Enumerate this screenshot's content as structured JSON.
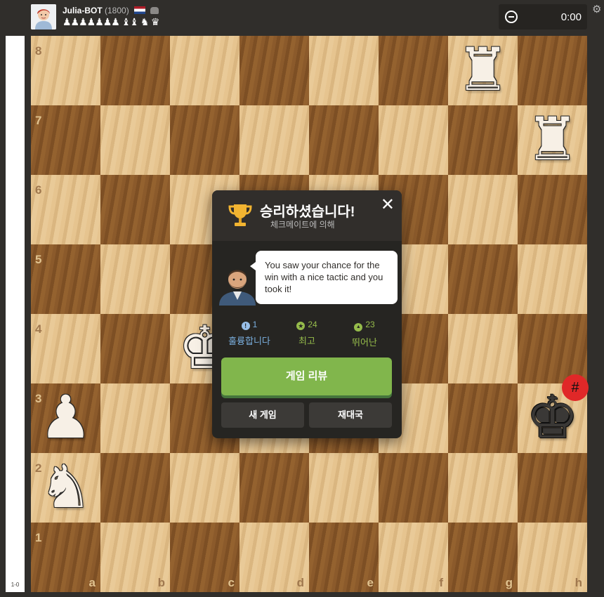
{
  "player": {
    "name": "Julia-BOT",
    "rating": "(1800)",
    "flag_icon": "netherlands-flag-icon",
    "bot_icon": "bot-icon",
    "captured": "♟♟♟♟♟♟♟ ♝♝ ♞ ♛"
  },
  "clock": {
    "icon": "timer-icon",
    "time": "0:00"
  },
  "settings_icon": "gear-icon",
  "eval": {
    "score": "1-0"
  },
  "board": {
    "ranks": [
      "8",
      "7",
      "6",
      "5",
      "4",
      "3",
      "2",
      "1"
    ],
    "files": [
      "a",
      "b",
      "c",
      "d",
      "e",
      "f",
      "g",
      "h"
    ],
    "pieces": [
      {
        "square": "g8",
        "symbol": "♜",
        "color": "white"
      },
      {
        "square": "h7",
        "symbol": "♜",
        "color": "white"
      },
      {
        "square": "c4",
        "symbol": "♚",
        "color": "white"
      },
      {
        "square": "a3",
        "symbol": "♟",
        "color": "white"
      },
      {
        "square": "a2",
        "symbol": "♞",
        "color": "white"
      },
      {
        "square": "h3",
        "symbol": "♚",
        "color": "black"
      }
    ],
    "checkmate_badge_icon": "checkmate-icon",
    "checkmate_badge_glyph": "#",
    "colors": {
      "light": "#e6c48f",
      "dark": "#8b5a2b"
    }
  },
  "result_modal": {
    "title": "승리하셨습니다!",
    "subtitle": "체크메이트에 의해",
    "coach_message": "You saw your chance for the win with a nice tactic and you took it!",
    "stats": [
      {
        "icon": "brilliant-icon",
        "glyph": "!",
        "count": "1",
        "label": "훌륭합니다",
        "color": "#7bb0e0"
      },
      {
        "icon": "best-icon",
        "glyph": "★",
        "count": "24",
        "label": "최고",
        "color": "#96bc4b"
      },
      {
        "icon": "great-icon",
        "glyph": "👍",
        "count": "23",
        "label": "뛰어난",
        "color": "#96bc4b"
      }
    ],
    "review_button": "게임 리뷰",
    "new_game_button": "새 게임",
    "rematch_button": "재대국",
    "close_icon": "✕",
    "accent": "#81b64c"
  }
}
